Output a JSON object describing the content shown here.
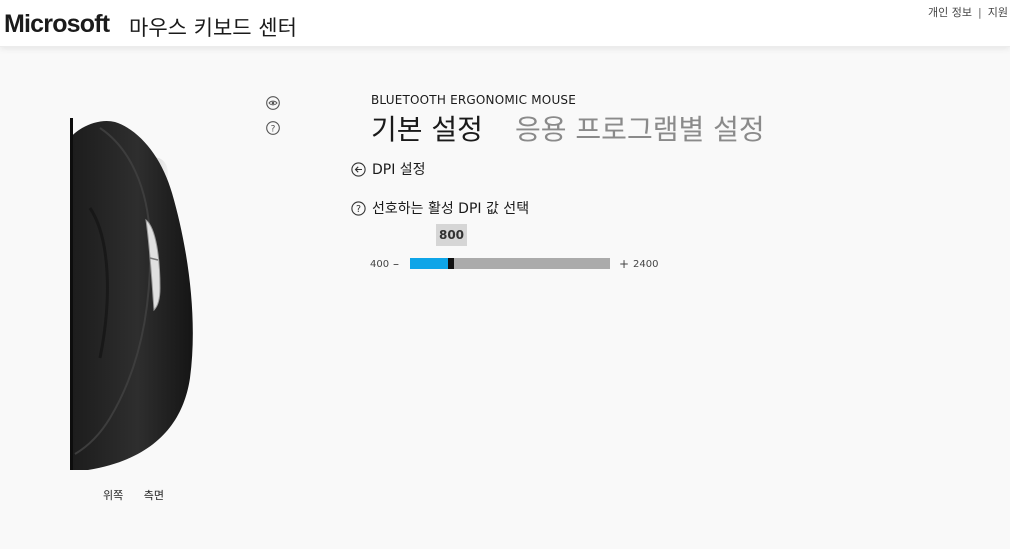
{
  "header": {
    "logo": "Microsoft",
    "app_title": "마우스 키보드 센터",
    "links": [
      "개인 정보",
      "지원"
    ],
    "separator": "|"
  },
  "device_view": {
    "labels": [
      "위쪽",
      "측면"
    ]
  },
  "main": {
    "device_name": "BLUETOOTH ERGONOMIC MOUSE",
    "tabs": [
      {
        "label": "기본 설정",
        "active": true
      },
      {
        "label": "응용 프로그램별 설정",
        "active": false
      }
    ],
    "back_label": "DPI 설정",
    "dpi_prompt": "선호하는 활성 DPI 값 선택",
    "dpi_slider": {
      "value": "800",
      "min": "400",
      "max": "2400",
      "minus_symbol": "–",
      "plus_symbol": "+",
      "fraction": 0.2
    }
  },
  "colors": {
    "accent": "#0ea5e8",
    "track": "#ababab",
    "thumb": "#111111",
    "bubble": "#d6d6d6"
  },
  "icons": [
    "eye-icon",
    "help-icon",
    "back-arrow-icon",
    "help-icon"
  ]
}
